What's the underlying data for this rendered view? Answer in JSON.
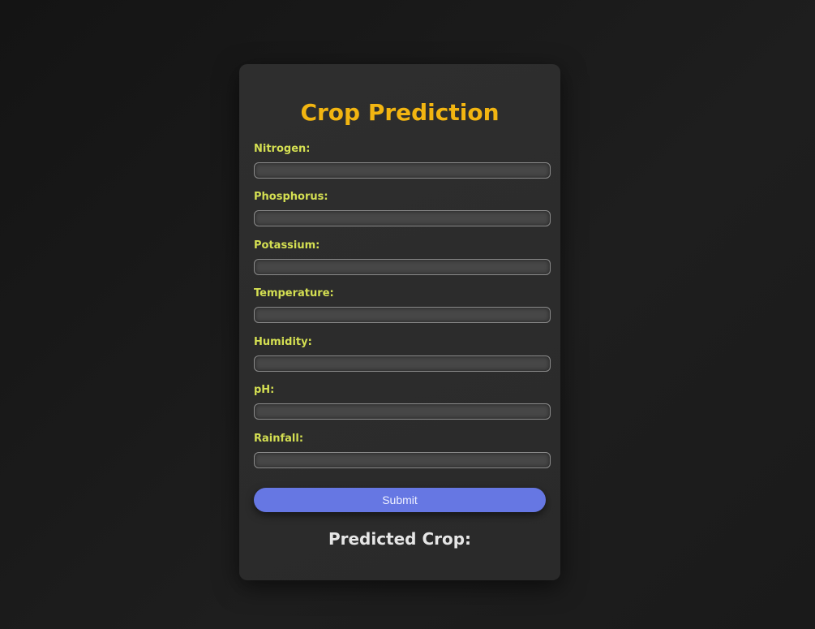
{
  "form": {
    "title": "Crop Prediction",
    "fields": [
      {
        "label": "Nitrogen:",
        "value": ""
      },
      {
        "label": "Phosphorus:",
        "value": ""
      },
      {
        "label": "Potassium:",
        "value": ""
      },
      {
        "label": "Temperature:",
        "value": ""
      },
      {
        "label": "Humidity:",
        "value": ""
      },
      {
        "label": "pH:",
        "value": ""
      },
      {
        "label": "Rainfall:",
        "value": ""
      }
    ],
    "submit_label": "Submit",
    "result_label": "Predicted Crop:"
  },
  "colors": {
    "title": "#f2b511",
    "label": "#d4df52",
    "button": "#6677e3",
    "card": "#2c2c2c",
    "background": "#181818"
  }
}
